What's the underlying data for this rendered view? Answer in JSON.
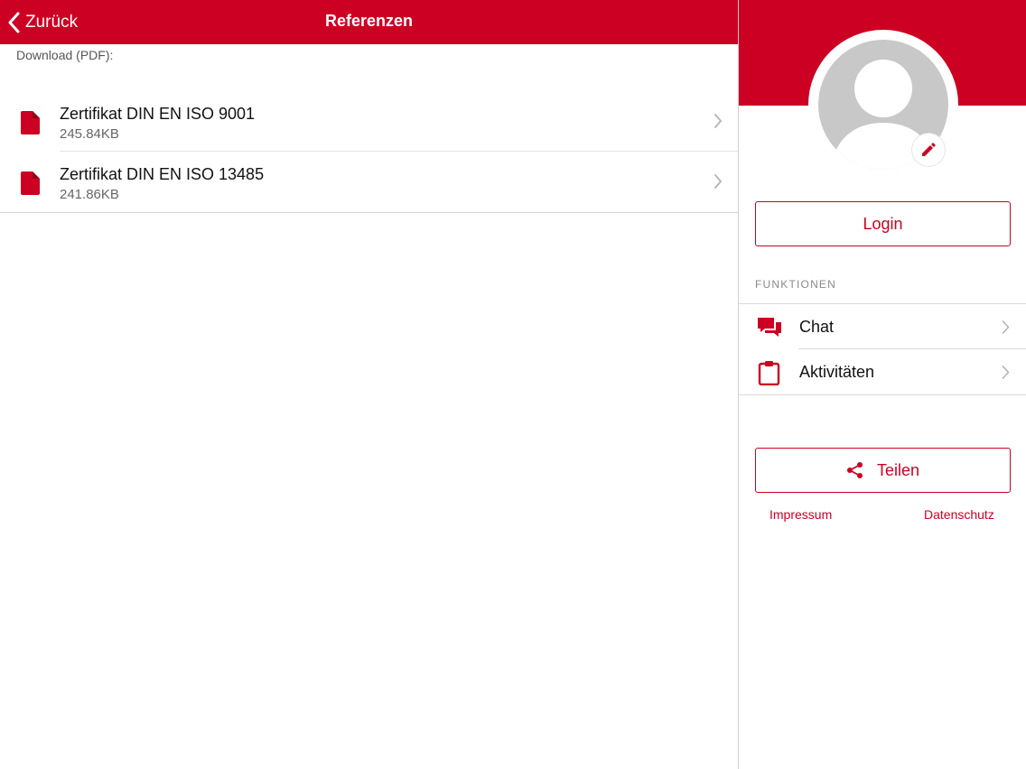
{
  "colors": {
    "brand": "#cc0022",
    "separator": "#dadada",
    "avatar": "#c8c8c8"
  },
  "navbar": {
    "back_label": "Zurück",
    "back_icon": "chevron-left-icon",
    "title": "Referenzen"
  },
  "downloads": {
    "section_label": "Download (PDF):",
    "files": [
      {
        "name": "Zertifikat DIN EN ISO 9001",
        "size": "245.84KB",
        "icon": "pdf-file-icon"
      },
      {
        "name": "Zertifikat DIN EN ISO 13485",
        "size": "241.86KB",
        "icon": "pdf-file-icon"
      }
    ]
  },
  "profile": {
    "avatar_icon": "user-placeholder-icon",
    "edit_icon": "pencil-icon",
    "login_label": "Login"
  },
  "functions": {
    "header": "FUNKTIONEN",
    "items": [
      {
        "label": "Chat",
        "icon": "chat-bubbles-icon"
      },
      {
        "label": "Aktivitäten",
        "icon": "clipboard-icon"
      }
    ]
  },
  "share": {
    "label": "Teilen",
    "icon": "share-icon"
  },
  "footer": {
    "impressum": "Impressum",
    "datenschutz": "Datenschutz"
  }
}
